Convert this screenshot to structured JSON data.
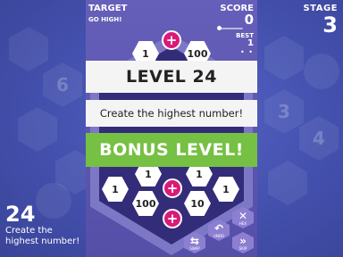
{
  "stage": {
    "label": "STAGE",
    "value": "3"
  },
  "objective": {
    "target_number": "24",
    "description": "Create the highest number!"
  },
  "hud": {
    "target_label": "TARGET",
    "target_value": "GO HIGH!",
    "score_label": "SCORE",
    "score_value": "0",
    "best_label": "BEST",
    "best_value": "1"
  },
  "banners": {
    "level": "LEVEL 24",
    "objective": "Create the highest number!",
    "bonus": "BONUS LEVEL!"
  },
  "board": {
    "tiles_top": [
      "1",
      "100"
    ],
    "tiles_row1": [
      "1",
      "1"
    ],
    "tiles_row2": [
      "1",
      "1"
    ],
    "tiles_row3": [
      "100",
      "10"
    ],
    "plus_symbol": "+"
  },
  "controls": [
    {
      "icon": "close-icon",
      "glyph": "✕",
      "label": "HEX"
    },
    {
      "icon": "undo-icon",
      "glyph": "↶",
      "label": "UNDO"
    },
    {
      "icon": "fast-forward-icon",
      "glyph": "»",
      "label": "SKIP"
    },
    {
      "icon": "swap-icon",
      "glyph": "⇆",
      "label": "SWAP"
    }
  ],
  "colors": {
    "background": "#4a56b6",
    "bonus_green": "#76c043",
    "plus_magenta": "#d81b78",
    "button_purple": "#8c7fd2"
  },
  "background_hex_numbers": [
    "6",
    "3",
    "4"
  ]
}
